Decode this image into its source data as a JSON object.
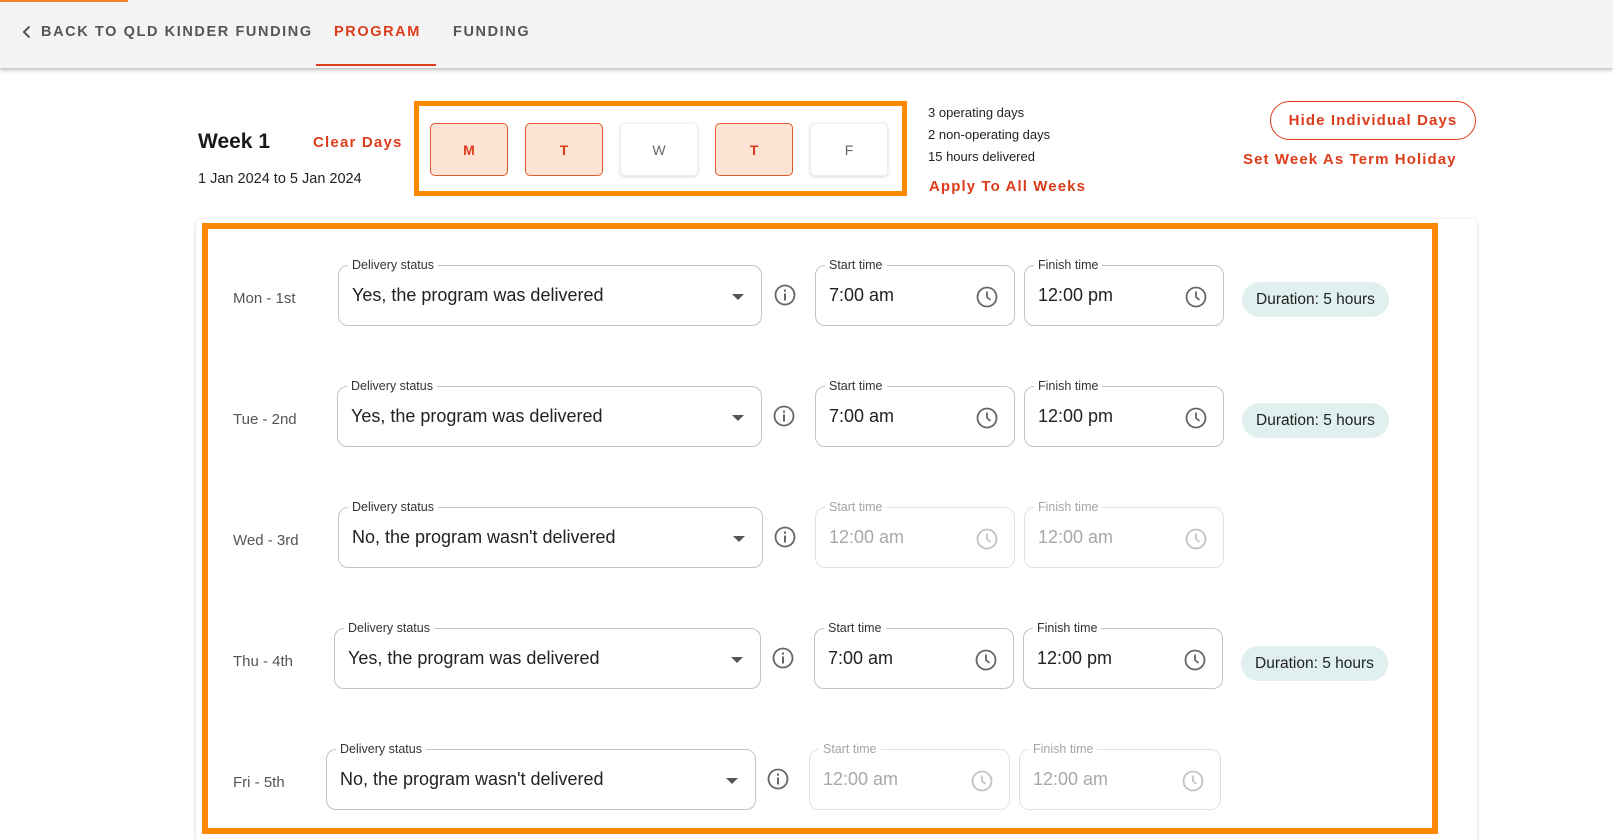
{
  "nav": {
    "back_label": "BACK TO QLD KINDER FUNDING",
    "tabs": [
      {
        "label": "PROGRAM",
        "active": true
      },
      {
        "label": "FUNDING",
        "active": false
      }
    ],
    "accent_color": "#dd3c1b"
  },
  "week": {
    "title": "Week 1",
    "date_range": "1 Jan 2024 to 5 Jan 2024",
    "clear_days_label": "Clear Days",
    "days": [
      {
        "letter": "M",
        "selected": true
      },
      {
        "letter": "T",
        "selected": true
      },
      {
        "letter": "W",
        "selected": false
      },
      {
        "letter": "T",
        "selected": true
      },
      {
        "letter": "F",
        "selected": false
      }
    ],
    "summary": {
      "operating": "3 operating days",
      "non_operating": "2 non-operating days",
      "hours": "15 hours delivered"
    },
    "apply_all_label": "Apply To All Weeks",
    "hide_days_label": "Hide Individual Days",
    "term_holiday_label": "Set Week As Term Holiday"
  },
  "labels": {
    "delivery_status": "Delivery status",
    "start_time": "Start time",
    "finish_time": "Finish time"
  },
  "day_rows": [
    {
      "day": "Mon - 1st",
      "status": "Yes, the program was delivered",
      "start": "7:00 am",
      "finish": "12:00 pm",
      "delivered": true,
      "duration": "Duration: 5 hours"
    },
    {
      "day": "Tue - 2nd",
      "status": "Yes, the program was delivered",
      "start": "7:00 am",
      "finish": "12:00 pm",
      "delivered": true,
      "duration": "Duration: 5 hours"
    },
    {
      "day": "Wed - 3rd",
      "status": "No, the program wasn't delivered",
      "start": "12:00 am",
      "finish": "12:00 am",
      "delivered": false,
      "duration": ""
    },
    {
      "day": "Thu - 4th",
      "status": "Yes, the program was delivered",
      "start": "7:00 am",
      "finish": "12:00 pm",
      "delivered": true,
      "duration": "Duration: 5 hours"
    },
    {
      "day": "Fri - 5th",
      "status": "No, the program wasn't delivered",
      "start": "12:00 am",
      "finish": "12:00 am",
      "delivered": false,
      "duration": ""
    }
  ],
  "icons": {
    "back": "chevron-left-icon",
    "info": "info-icon",
    "clock": "clock-icon",
    "dropdown": "caret-down-icon"
  },
  "colors": {
    "highlight_frame": "#ff8a00",
    "selected_day_bg": "#fde3d4",
    "duration_badge_bg": "#dff0ef"
  }
}
